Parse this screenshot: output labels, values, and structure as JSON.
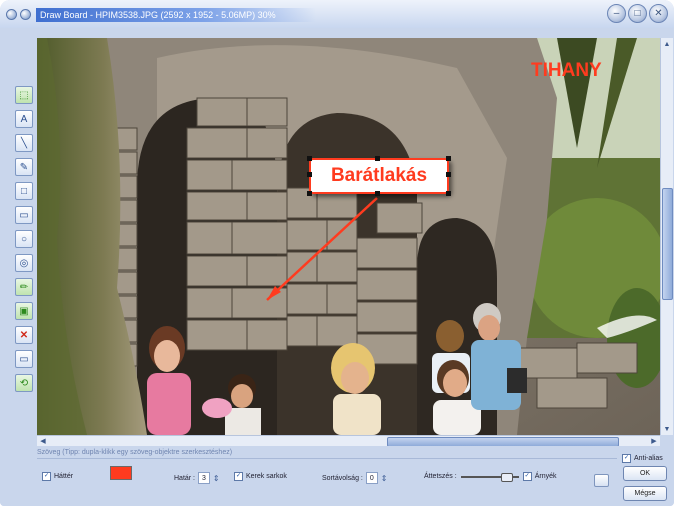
{
  "window": {
    "title": "Draw Board  -  HPIM3538.JPG  (2592 x 1952 - 5.06MP)   30%",
    "controls": [
      "minimize-icon",
      "maximize-icon",
      "close-icon"
    ]
  },
  "tools": [
    {
      "name": "select-tool",
      "glyph": "⬚",
      "style": "green"
    },
    {
      "name": "text-tool",
      "glyph": "A"
    },
    {
      "name": "line-tool",
      "glyph": "╲"
    },
    {
      "name": "pen-tool",
      "glyph": "✎"
    },
    {
      "name": "rect-tool",
      "glyph": "□"
    },
    {
      "name": "filled-rect-tool",
      "glyph": "▭"
    },
    {
      "name": "ellipse-tool",
      "glyph": "○"
    },
    {
      "name": "filled-ellipse-tool",
      "glyph": "◎"
    },
    {
      "name": "highlight-tool",
      "glyph": "✏",
      "style": "green"
    },
    {
      "name": "image-tool",
      "glyph": "▣",
      "style": "green"
    },
    {
      "name": "delete-tool",
      "glyph": "✕",
      "style": "red"
    },
    {
      "name": "crop-tool",
      "glyph": "▭"
    },
    {
      "name": "zoom-tool",
      "glyph": "⟲",
      "style": "green"
    }
  ],
  "canvas": {
    "watermark": "TIHANY",
    "callout_text": "Barátlakás"
  },
  "panel": {
    "hint": "Szöveg (Tipp: dupla-klikk egy szöveg-objektre szerkesztéshez)",
    "hatter_label": "Háttér",
    "hatter_checked": true,
    "fill_color": "#ff3b1f",
    "hatar_label": "Határ :",
    "hatar_value": "3",
    "kerek_label": "Kerek sarkok",
    "kerek_checked": true,
    "sortav_label": "Sortávolság :",
    "sortav_value": "0",
    "attetszo_label": "Áttetszés :",
    "attetszo_level": 0.85,
    "arnyek_label": "Árnyék",
    "arnyek_checked": true,
    "antialias_label": "Anti-alias",
    "antialias_checked": true,
    "ok_label": "OK",
    "cancel_label": "Mégse"
  }
}
